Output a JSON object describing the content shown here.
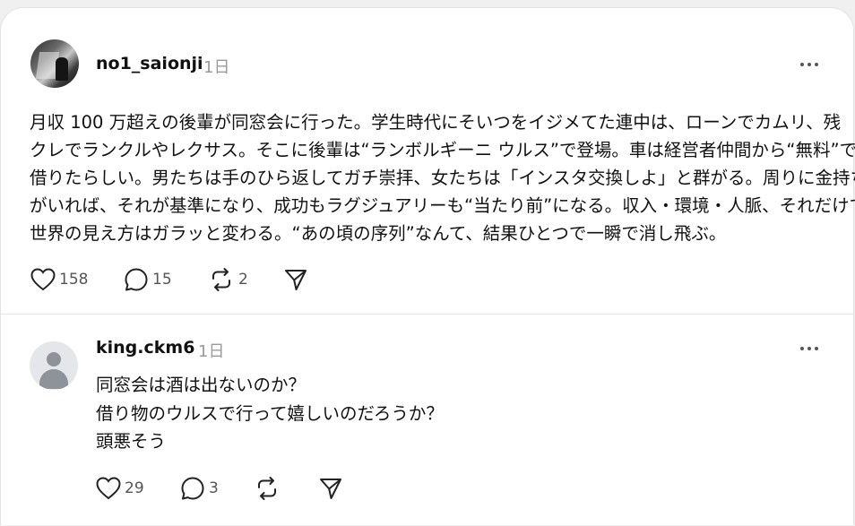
{
  "post": {
    "username": "no1_saionji",
    "time": "1日",
    "lines": [
      "月収 100 万超えの後輩が同窓会に行った。学生時代にそいつをイジメてた連中は、ローンでカムリ、残",
      "クレでランクルやレクサス。そこに後輩は“ランボルギーニ ウルス”で登場。車は経営者仲間から“無料”で",
      "借りたらしい。男たちは手のひら返してガチ崇拝、女たちは「インスタ交換しよ」と群がる。周りに金持ち",
      "がいれば、それが基準になり、成功もラグジュアリーも“当たり前”になる。収入・環境・人脈、それだけで",
      "世界の見え方はガラッと変わる。“あの頃の序列”なんて、結果ひとつで一瞬で消し飛ぶ。"
    ],
    "actions": {
      "likes": "158",
      "comments": "15",
      "reposts": "2"
    }
  },
  "reply": {
    "username": "king.ckm6",
    "time": "1日",
    "lines": [
      "同窓会は酒は出ないのか？",
      "借り物のウルスで行って嬉しいのだろうか？",
      "頭悪そう"
    ],
    "actions": {
      "likes": "29",
      "comments": "3"
    }
  },
  "icons": [
    "more-icon",
    "heart-icon",
    "comment-icon",
    "repost-icon",
    "share-icon"
  ]
}
